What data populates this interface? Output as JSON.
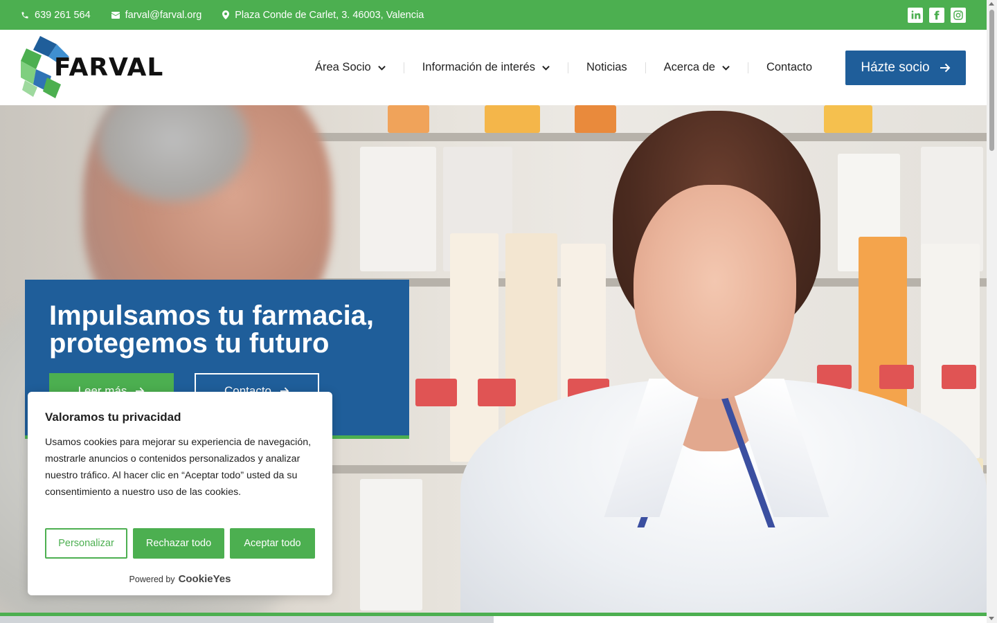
{
  "topbar": {
    "phone": "639 261 564",
    "email": "farval@farval.org",
    "address": "Plaza Conde de Carlet, 3. 46003, Valencia",
    "socials": [
      "linkedin-icon",
      "facebook-icon",
      "instagram-icon"
    ]
  },
  "header": {
    "logo_text": "FARVAL",
    "nav": [
      {
        "label": "Área Socio",
        "dropdown": true
      },
      {
        "label": "Información de interés",
        "dropdown": true
      },
      {
        "label": "Noticias",
        "dropdown": false
      },
      {
        "label": "Acerca de",
        "dropdown": true
      },
      {
        "label": "Contacto",
        "dropdown": false
      }
    ],
    "cta_label": "Házte socio"
  },
  "hero": {
    "title": "Impulsamos tu farmacia, protegemos tu futuro",
    "btn_more": "Leer más",
    "btn_contact": "Contacto"
  },
  "cookie": {
    "title": "Valoramos tu privacidad",
    "text": "Usamos cookies para mejorar su experiencia de navegación, mostrarle anuncios o contenidos personalizados y analizar nuestro tráfico. Al hacer clic en “Aceptar todo” usted da su consentimiento a nuestro uso de las cookies.",
    "btn_customize": "Personalizar",
    "btn_reject": "Rechazar todo",
    "btn_accept": "Aceptar todo",
    "powered_by": "Powered by",
    "brand": "CookieYes"
  },
  "colors": {
    "green": "#4caf50",
    "blue": "#1f5e9a"
  }
}
